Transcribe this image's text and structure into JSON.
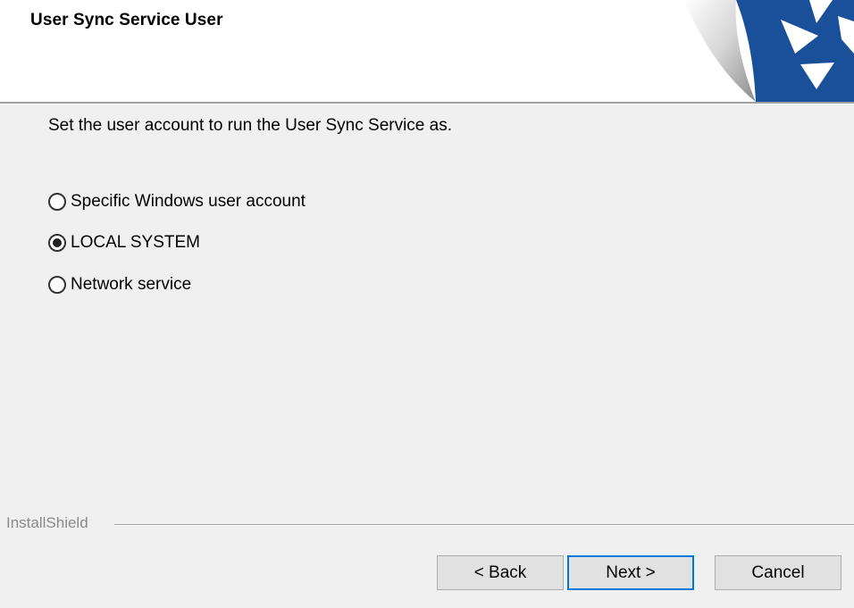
{
  "header": {
    "title": "User Sync Service User",
    "logo_icon": "installer-page-curl-logo-icon"
  },
  "instruction": "Set the user account to run the User Sync Service as.",
  "options": [
    {
      "label": "Specific Windows user account",
      "selected": false
    },
    {
      "label": "LOCAL SYSTEM",
      "selected": true
    },
    {
      "label": "Network service",
      "selected": false
    }
  ],
  "footer": {
    "brand": "InstallShield",
    "back_label": "< Back",
    "next_label": "Next >",
    "cancel_label": "Cancel"
  },
  "colors": {
    "accent": "#0078d7",
    "logo_blue": "#1a4f9a",
    "background": "#f0f0f0"
  }
}
